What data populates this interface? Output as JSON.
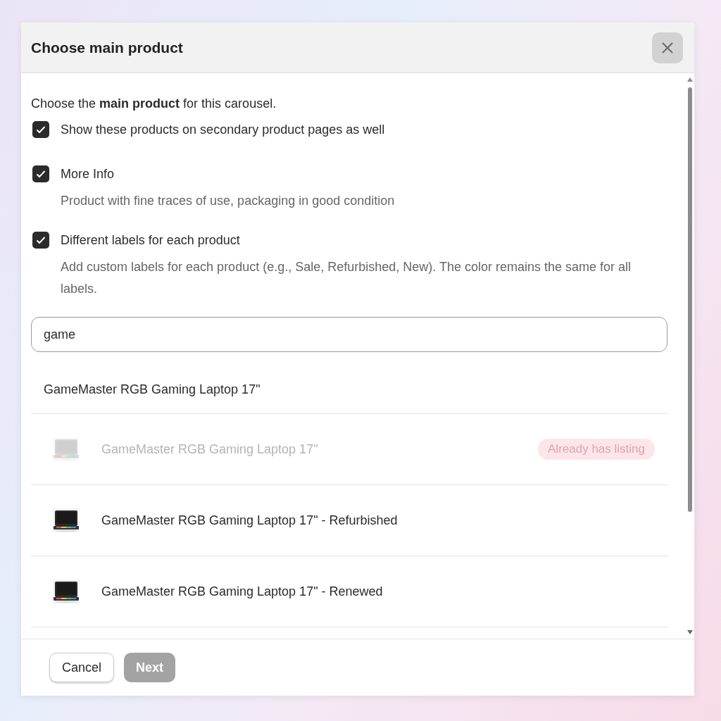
{
  "dialog": {
    "title": "Choose main product",
    "intro": "Choose the **main product** for this carousel.",
    "options": [
      {
        "label": "Show these products on secondary product pages as well",
        "checked": true
      },
      {
        "label": "More Info",
        "description": "Product with fine traces of use, packaging in good condition",
        "checked": true
      },
      {
        "label": "Different labels for each product",
        "description": "Add custom labels for each product (e.g., Sale, Refurbished, New). The color remains the same for all labels.",
        "checked": true
      }
    ],
    "search": {
      "value": "game"
    },
    "group": {
      "title": "GameMaster RGB Gaming Laptop 17\"",
      "items": [
        {
          "name": "GameMaster RGB Gaming Laptop 17\"",
          "disabled": true,
          "badge": "Already has listing"
        },
        {
          "name": "GameMaster RGB Gaming Laptop 17\" - Refurbished",
          "disabled": false
        },
        {
          "name": "GameMaster RGB Gaming Laptop 17\" - Renewed",
          "disabled": false
        }
      ]
    },
    "buttons": [
      {
        "label": "Cancel",
        "kind": "secondary",
        "disabled": false
      },
      {
        "label": "Next",
        "kind": "primary",
        "disabled": true
      }
    ]
  }
}
